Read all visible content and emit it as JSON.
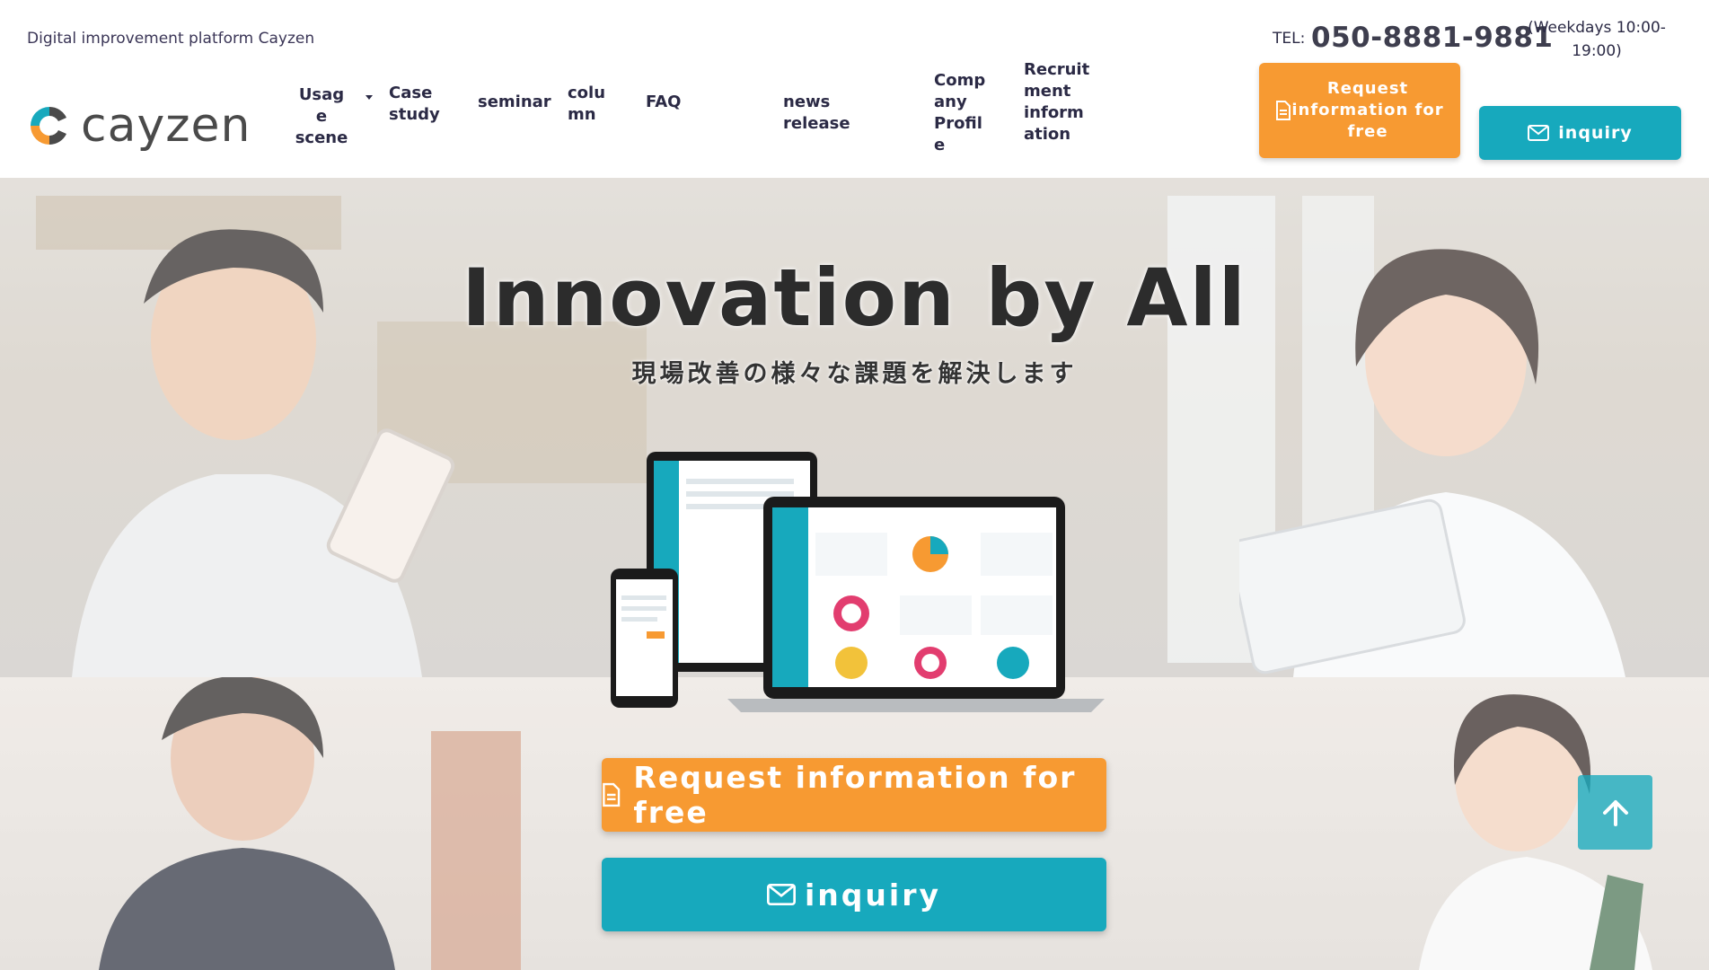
{
  "header": {
    "tagline": "Digital improvement platform Cayzen",
    "logo_text": "cayzen",
    "nav": [
      {
        "label": "Usage scene"
      },
      {
        "label": "Case study"
      },
      {
        "label": "seminar"
      },
      {
        "label": "column"
      },
      {
        "label": "FAQ"
      },
      {
        "label": "news release"
      },
      {
        "label": "Company Profile"
      },
      {
        "label": "Recruitment information"
      }
    ],
    "tel_label": "TEL:",
    "tel_number": "050-8881-9881",
    "tel_hours": "(Weekdays 10:00-19:00)",
    "request_button_label": "Request information for free",
    "inquiry_button_label": "inquiry"
  },
  "hero": {
    "title": "Innovation by All",
    "subtitle": "現場改善の様々な課題を解決します",
    "cta_request_label": "Request information for free",
    "cta_inquiry_label": "inquiry"
  },
  "colors": {
    "accent_orange": "#f79a32",
    "accent_teal": "#17a9bd",
    "nav_text": "#2b2a45"
  },
  "icons": {
    "document": "document-icon",
    "mail": "mail-icon",
    "scroll_top": "arrow-up-icon"
  }
}
